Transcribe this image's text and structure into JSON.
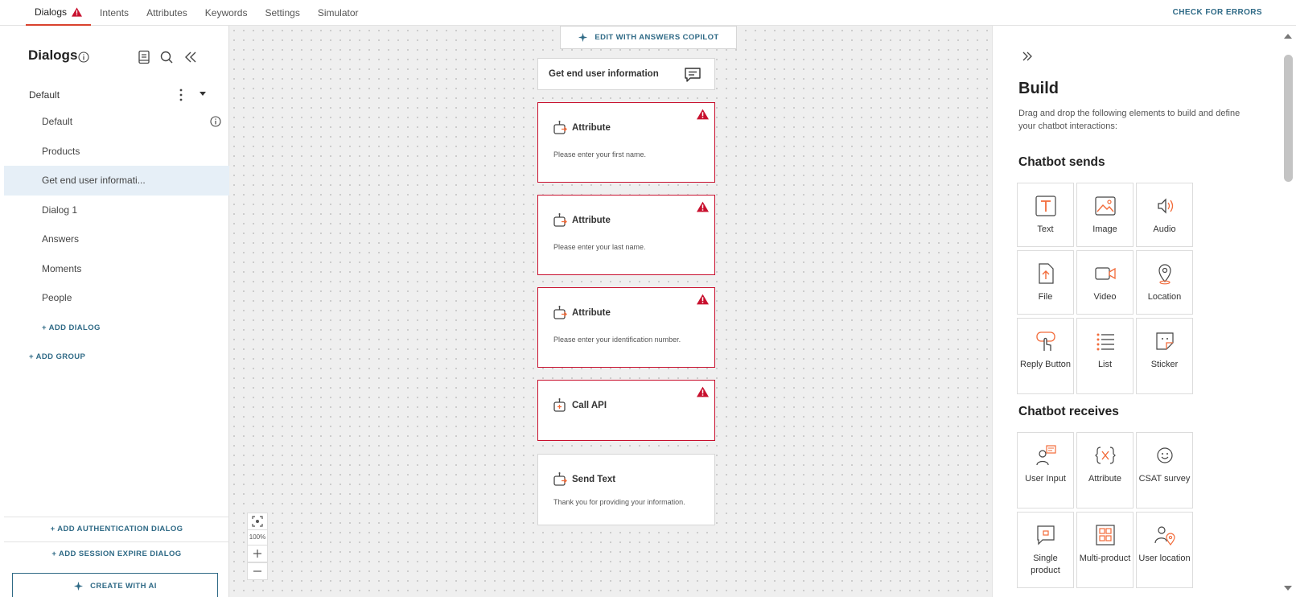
{
  "topnav": {
    "tabs": [
      {
        "label": "Dialogs",
        "active": true,
        "has_error": true
      },
      {
        "label": "Intents"
      },
      {
        "label": "Attributes"
      },
      {
        "label": "Keywords"
      },
      {
        "label": "Settings"
      },
      {
        "label": "Simulator"
      }
    ],
    "check_errors": "CHECK FOR ERRORS"
  },
  "sidebar": {
    "title": "Dialogs",
    "group": {
      "label": "Default"
    },
    "dialogs": [
      {
        "label": "Default"
      },
      {
        "label": "Products"
      },
      {
        "label": "Get end user informati..."
      },
      {
        "label": "Dialog 1"
      },
      {
        "label": "Answers"
      },
      {
        "label": "Moments"
      },
      {
        "label": "People"
      }
    ],
    "add_dialog": "+ ADD DIALOG",
    "add_group": "+ ADD GROUP",
    "add_auth_dialog": "+ ADD AUTHENTICATION DIALOG",
    "add_session_expire_dialog": "+ ADD SESSION EXPIRE DIALOG",
    "create_with_ai": "CREATE WITH AI"
  },
  "canvas": {
    "copilot_button": "EDIT WITH ANSWERS COPILOT",
    "dialog_name": "Get end user information",
    "nodes": [
      {
        "title": "Attribute",
        "text": "Please enter your first name.",
        "error": true
      },
      {
        "title": "Attribute",
        "text": "Please enter your last name.",
        "error": true
      },
      {
        "title": "Attribute",
        "text": "Please enter your identification number.",
        "error": true
      },
      {
        "title": "Call API",
        "text": "",
        "error": true
      },
      {
        "title": "Send Text",
        "text": "Thank you for providing your information.",
        "error": false
      }
    ],
    "zoom_level": "100%"
  },
  "build_panel": {
    "title": "Build",
    "description": "Drag and drop the following elements to build and define your chatbot interactions:",
    "sends_title": "Chatbot sends",
    "sends": [
      {
        "label": "Text",
        "icon": "text-icon"
      },
      {
        "label": "Image",
        "icon": "image-icon"
      },
      {
        "label": "Audio",
        "icon": "audio-icon"
      },
      {
        "label": "File",
        "icon": "file-icon"
      },
      {
        "label": "Video",
        "icon": "video-icon"
      },
      {
        "label": "Location",
        "icon": "location-icon"
      },
      {
        "label": "Reply Button",
        "icon": "reply-button-icon"
      },
      {
        "label": "List",
        "icon": "list-icon"
      },
      {
        "label": "Sticker",
        "icon": "sticker-icon"
      }
    ],
    "receives_title": "Chatbot receives",
    "receives": [
      {
        "label": "User Input",
        "icon": "user-input-icon"
      },
      {
        "label": "Attribute",
        "icon": "attribute-icon"
      },
      {
        "label": "CSAT survey",
        "icon": "csat-icon"
      },
      {
        "label": "Single product",
        "icon": "single-product-icon"
      },
      {
        "label": "Multi-product",
        "icon": "multi-product-icon"
      },
      {
        "label": "User location",
        "icon": "user-location-icon"
      }
    ]
  },
  "colors": {
    "accent": "#2f6a86",
    "error": "#c8102e",
    "brand": "#f26b3a",
    "selected_bg": "#e6eff7"
  }
}
